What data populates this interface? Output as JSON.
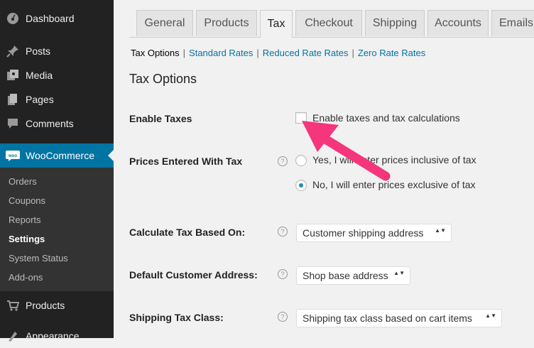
{
  "sidebar": {
    "items": [
      {
        "label": "Dashboard",
        "icon": "dashboard-icon"
      },
      {
        "label": "Posts",
        "icon": "pin-icon"
      },
      {
        "label": "Media",
        "icon": "media-icon"
      },
      {
        "label": "Pages",
        "icon": "pages-icon"
      },
      {
        "label": "Comments",
        "icon": "comment-icon"
      },
      {
        "label": "WooCommerce",
        "icon": "woocommerce-icon"
      }
    ],
    "submenu": [
      "Orders",
      "Coupons",
      "Reports",
      "Settings",
      "System Status",
      "Add-ons"
    ],
    "submenu_active": "Settings",
    "after": [
      {
        "label": "Products",
        "icon": "products-icon"
      },
      {
        "label": "Appearance",
        "icon": "appearance-icon"
      }
    ]
  },
  "tabs": [
    "General",
    "Products",
    "Tax",
    "Checkout",
    "Shipping",
    "Accounts",
    "Emails"
  ],
  "active_tab": "Tax",
  "subsections": {
    "current": "Tax Options",
    "links": [
      "Standard Rates",
      "Reduced Rate Rates",
      "Zero Rate Rates"
    ],
    "separator": "|"
  },
  "section_title": "Tax Options",
  "fields": {
    "enable_taxes": {
      "label": "Enable Taxes",
      "option": "Enable taxes and tax calculations",
      "checked": false
    },
    "prices_entered": {
      "label": "Prices Entered With Tax",
      "options": [
        "Yes, I will enter prices inclusive of tax",
        "No, I will enter prices exclusive of tax"
      ],
      "selected": 1
    },
    "calculate_based_on": {
      "label": "Calculate Tax Based On:",
      "value": "Customer shipping address"
    },
    "default_address": {
      "label": "Default Customer Address:",
      "value": "Shop base address"
    },
    "shipping_tax_class": {
      "label": "Shipping Tax Class:",
      "value": "Shipping tax class based on cart items"
    }
  },
  "help_glyph": "?",
  "select_arrows": "▲▼",
  "colors": {
    "sidebar_bg": "#222222",
    "sidebar_current": "#0074a2",
    "link": "#0074a2",
    "annotation_arrow": "#f5357c"
  }
}
